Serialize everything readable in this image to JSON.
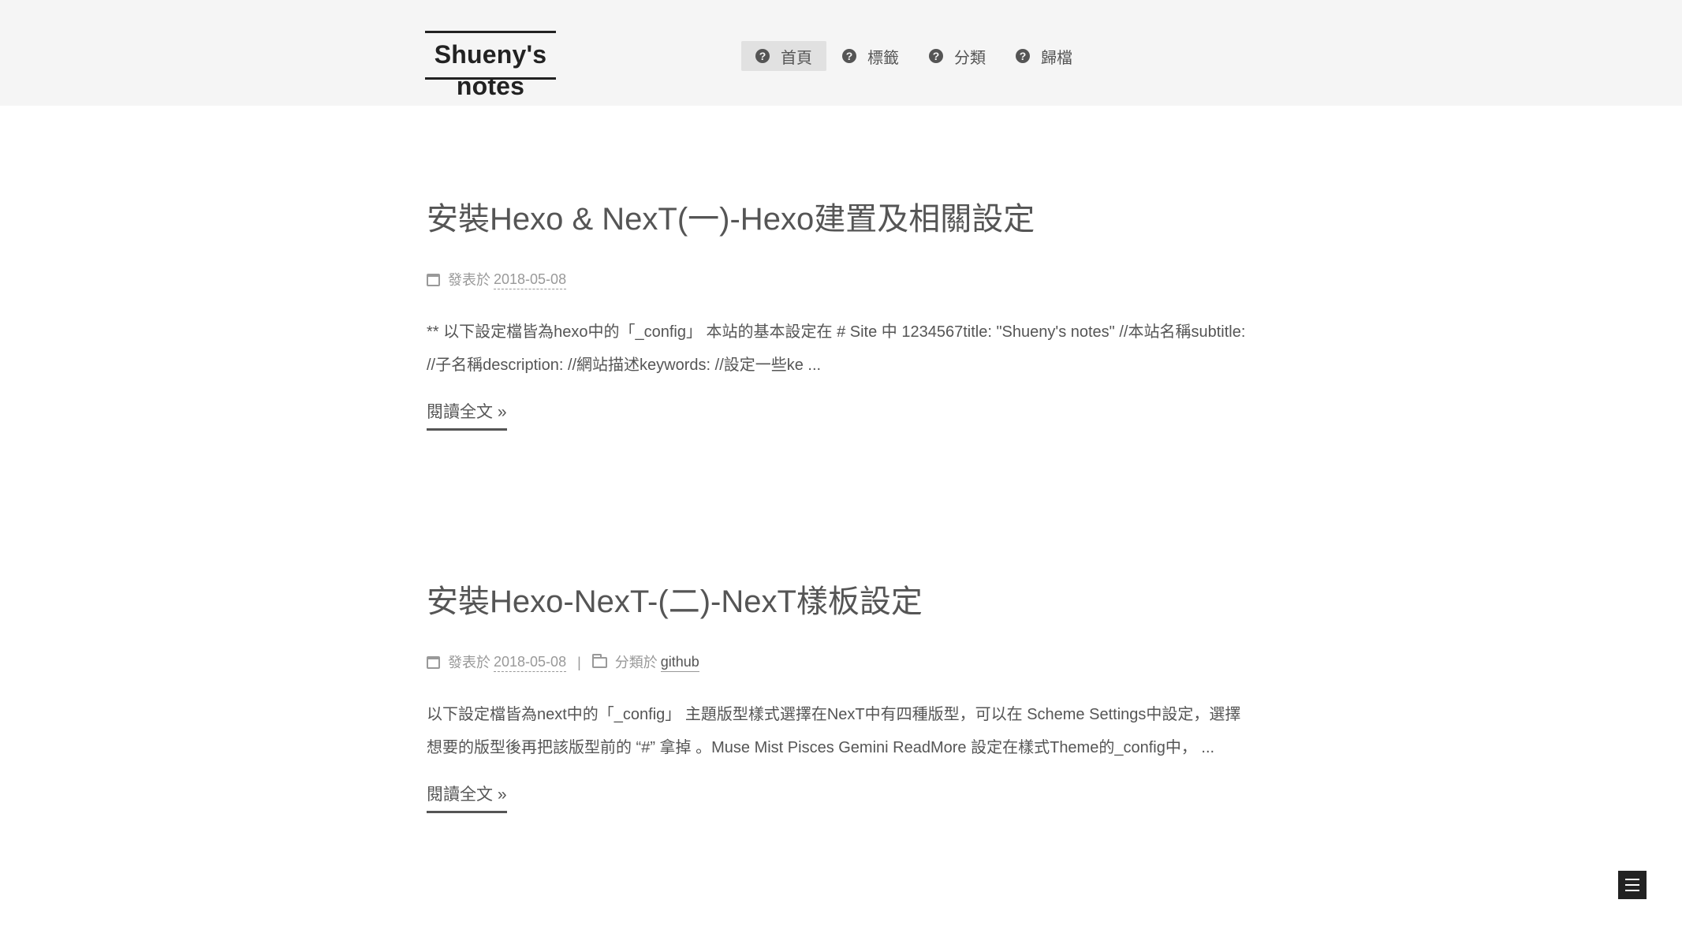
{
  "site": {
    "brand_title": "Shueny's notes"
  },
  "menu": {
    "items": [
      {
        "label": "首頁",
        "icon": "question-circle-icon",
        "active": true
      },
      {
        "label": "標籤",
        "icon": "question-circle-icon",
        "active": false
      },
      {
        "label": "分類",
        "icon": "question-circle-icon",
        "active": false
      },
      {
        "label": "歸檔",
        "icon": "question-circle-icon",
        "active": false
      }
    ]
  },
  "posts": [
    {
      "title": "安裝Hexo & NexT(一)-Hexo建置及相關設定",
      "posted_label": "發表於",
      "date": "2018-05-08",
      "excerpt": "** 以下設定檔皆為hexo中的「_config」 本站的基本設定在 # Site 中 1234567title: \"Shueny's notes\" //本站名稱subtitle: //子名稱description: //網站描述keywords: //設定一些ke ...",
      "read_more": "閱讀全文 »"
    },
    {
      "title": "安裝Hexo-NexT-(二)-NexT樣板設定",
      "posted_label": "發表於",
      "date": "2018-05-08",
      "separator": "|",
      "category_label": "分類於",
      "category": "github",
      "excerpt": "以下設定檔皆為next中的「_config」 主題版型樣式選擇在NexT中有四種版型，可以在 Scheme Settings中設定，選擇想要的版型後再把該版型前的 “#” 拿掉 。Muse Mist Pisces Gemini ReadMore 設定在樣式Theme的_config中， ...",
      "read_more": "閱讀全文 »"
    }
  ],
  "colors": {
    "header_bg": "#f5f5f5",
    "text": "#555555",
    "meta": "#999999",
    "brand": "#222222",
    "active_menu_bg": "#e1e1e1"
  }
}
